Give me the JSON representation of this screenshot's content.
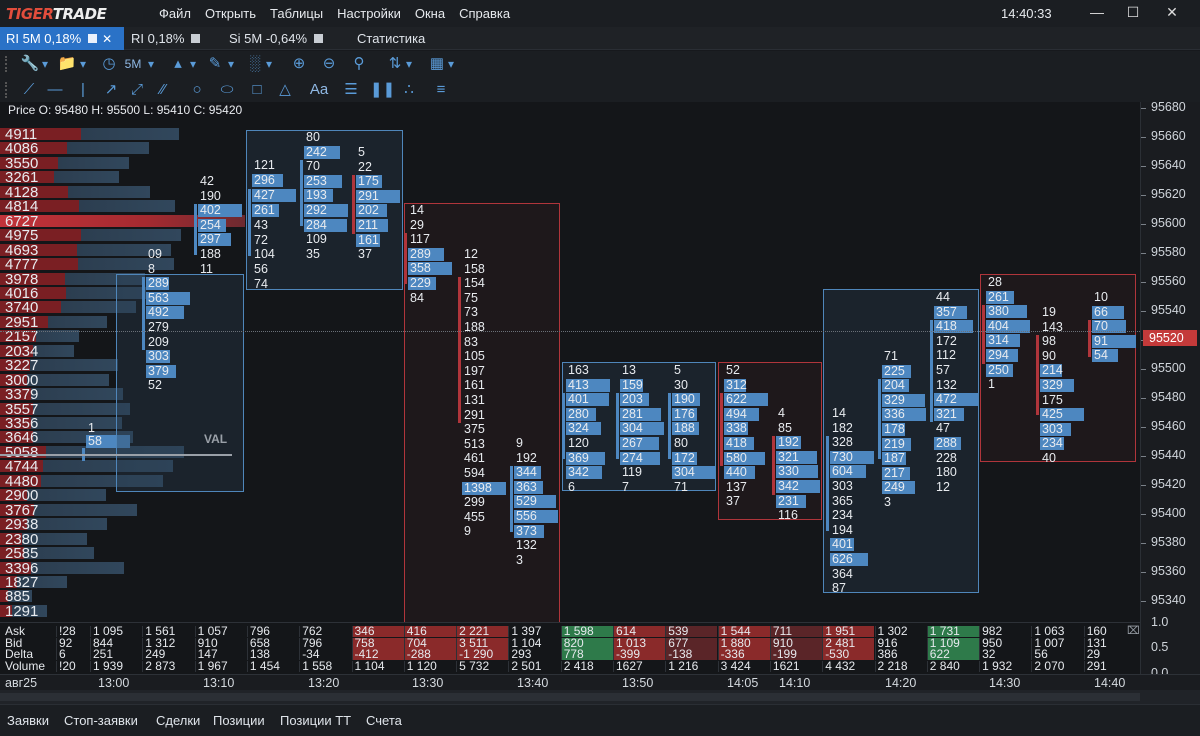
{
  "app": {
    "logo": "TIGERTRADE",
    "clock": "14:40:33"
  },
  "menu": [
    "Файл",
    "Открыть",
    "Таблицы",
    "Настройки",
    "Окна",
    "Справка"
  ],
  "tabs": [
    {
      "label": "RI 5M 0,18%",
      "active": true
    },
    {
      "label": "RI 0,18%",
      "active": false
    },
    {
      "label": "Si 5M -0,64%",
      "active": false
    },
    {
      "label": "Статистика",
      "active": false
    }
  ],
  "toolbar": {
    "timeframe": "5M",
    "text_tool": "Aa"
  },
  "chart": {
    "ohlc": "Price O: 95480 H: 95500 L: 95410 C: 95420",
    "val_label": "VAL",
    "price_axis": [
      "95680",
      "95660",
      "95640",
      "95620",
      "95600",
      "95580",
      "95560",
      "95540",
      "95520",
      "95500",
      "95480",
      "95460",
      "95440",
      "95420",
      "95400",
      "95380",
      "95360",
      "95340"
    ],
    "current_price": "95520",
    "volume_profile": [
      "4911",
      "4086",
      "3550",
      "3261",
      "4128",
      "4814",
      "6727",
      "4975",
      "4693",
      "4777",
      "3978",
      "4016",
      "3740",
      "2951",
      "2157",
      "2034",
      "3227",
      "3000",
      "3379",
      "3557",
      "3356",
      "3646",
      "5058",
      "4744",
      "4480",
      "2900",
      "3767",
      "2938",
      "2380",
      "2585",
      "3396",
      "1827",
      "885",
      "1291"
    ],
    "clusters": [
      {
        "values": [
          "1",
          "58"
        ]
      },
      {
        "values": [
          "09",
          "8",
          "289",
          "563",
          "492",
          "279",
          "209",
          "303",
          "379",
          "52"
        ]
      },
      {
        "values": [
          "42",
          "190",
          "402",
          "254",
          "297",
          "188",
          "11"
        ]
      },
      {
        "values": [
          "121",
          "296",
          "427",
          "261",
          "43",
          "72",
          "104",
          "56",
          "74"
        ]
      },
      {
        "values": [
          "80",
          "242",
          "70",
          "253",
          "193",
          "292",
          "284",
          "109",
          "35"
        ]
      },
      {
        "values": [
          "5",
          "22",
          "175",
          "291",
          "202",
          "211",
          "161",
          "37"
        ]
      },
      {
        "values": [
          "14",
          "29",
          "117",
          "289",
          "358",
          "229",
          "84"
        ]
      },
      {
        "values": [
          "12",
          "158",
          "154",
          "75",
          "73",
          "188",
          "83",
          "105",
          "197",
          "161",
          "131",
          "291",
          "375",
          "513",
          "461",
          "594",
          "1398",
          "299",
          "455",
          "9"
        ]
      },
      {
        "values": [
          "9",
          "192",
          "344",
          "363",
          "529",
          "556",
          "373",
          "132",
          "3"
        ]
      },
      {
        "values": [
          "163",
          "413",
          "401",
          "280",
          "324",
          "120",
          "369",
          "342",
          "6"
        ]
      },
      {
        "values": [
          "13",
          "159",
          "203",
          "281",
          "304",
          "267",
          "274",
          "119",
          "7"
        ]
      },
      {
        "values": [
          "5",
          "30",
          "190",
          "176",
          "188",
          "80",
          "172",
          "304",
          "71"
        ]
      },
      {
        "values": [
          "52",
          "312",
          "622",
          "494",
          "338",
          "418",
          "580",
          "440",
          "137",
          "37"
        ]
      },
      {
        "values": [
          "4",
          "85",
          "192",
          "321",
          "330",
          "342",
          "231",
          "116"
        ]
      },
      {
        "values": [
          "14",
          "182",
          "328",
          "730",
          "604",
          "303",
          "365",
          "234",
          "194",
          "401",
          "626",
          "364",
          "87"
        ]
      },
      {
        "values": [
          "71",
          "225",
          "204",
          "329",
          "336",
          "178",
          "219",
          "187",
          "217",
          "249",
          "3"
        ]
      },
      {
        "values": [
          "44",
          "357",
          "418",
          "172",
          "112",
          "57",
          "132",
          "472",
          "321",
          "47",
          "288",
          "228",
          "180",
          "12"
        ]
      },
      {
        "values": [
          "28",
          "261",
          "380",
          "404",
          "314",
          "294",
          "250",
          "1"
        ]
      },
      {
        "values": [
          "19",
          "143",
          "98",
          "90",
          "214",
          "329",
          "175",
          "425",
          "303",
          "234",
          "40"
        ]
      },
      {
        "values": [
          "10",
          "66",
          "70",
          "91",
          "54"
        ]
      }
    ]
  },
  "stats": {
    "row_labels": [
      "Ask",
      "Bid",
      "Delta",
      "Volume"
    ],
    "columns": [
      {
        "ask": "!28",
        "bid": "92",
        "delta": "6",
        "volume": "!20"
      },
      {
        "ask": "1 095",
        "bid": "844",
        "delta": "251",
        "volume": "1 939"
      },
      {
        "ask": "1 561",
        "bid": "1 312",
        "delta": "249",
        "volume": "2 873"
      },
      {
        "ask": "1 057",
        "bid": "910",
        "delta": "147",
        "volume": "1 967"
      },
      {
        "ask": "796",
        "bid": "658",
        "delta": "138",
        "volume": "1 454"
      },
      {
        "ask": "762",
        "bid": "796",
        "delta": "-34",
        "volume": "1 558"
      },
      {
        "ask": "346",
        "bid": "758",
        "delta": "-412",
        "volume": "1 104"
      },
      {
        "ask": "416",
        "bid": "704",
        "delta": "-288",
        "volume": "1 120"
      },
      {
        "ask": "2 221",
        "bid": "3 511",
        "delta": "-1 290",
        "volume": "5 732"
      },
      {
        "ask": "1 397",
        "bid": "1 104",
        "delta": "293",
        "volume": "2 501"
      },
      {
        "ask": "1 598",
        "bid": "820",
        "delta": "778",
        "volume": "2 418"
      },
      {
        "ask": "614",
        "bid": "1 013",
        "delta": "-399",
        "volume": "1627"
      },
      {
        "ask": "539",
        "bid": "677",
        "delta": "-138",
        "volume": "1 216"
      },
      {
        "ask": "1 544",
        "bid": "1 880",
        "delta": "-336",
        "volume": "3 424"
      },
      {
        "ask": "711",
        "bid": "910",
        "delta": "-199",
        "volume": "1621"
      },
      {
        "ask": "1 951",
        "bid": "2 481",
        "delta": "-530",
        "volume": "4 432"
      },
      {
        "ask": "1 302",
        "bid": "916",
        "delta": "386",
        "volume": "2 218"
      },
      {
        "ask": "1 731",
        "bid": "1 109",
        "delta": "622",
        "volume": "2 840"
      },
      {
        "ask": "982",
        "bid": "950",
        "delta": "32",
        "volume": "1 932"
      },
      {
        "ask": "1 063",
        "bid": "1 007",
        "delta": "56",
        "volume": "2 070"
      },
      {
        "ask": "160",
        "bid": "131",
        "delta": "29",
        "volume": "291"
      }
    ],
    "axis": [
      "1.0",
      "0.5",
      "0.0"
    ]
  },
  "time_axis": [
    "авг25",
    "13:00",
    "13:10",
    "13:20",
    "13:30",
    "13:40",
    "13:50",
    "14:05",
    "14:10",
    "14:20",
    "14:30",
    "14:40"
  ],
  "bottom_tabs": [
    "Заявки",
    "Стоп-заявки",
    "Сделки",
    "Позиции",
    "Позиции ТТ",
    "Счета"
  ],
  "colors": {
    "accent": "#2a72c7",
    "up": "#4d87c0",
    "down": "#c43a3a",
    "ask_green": "#2e7a4a",
    "bid_red": "#8a2a2a"
  }
}
